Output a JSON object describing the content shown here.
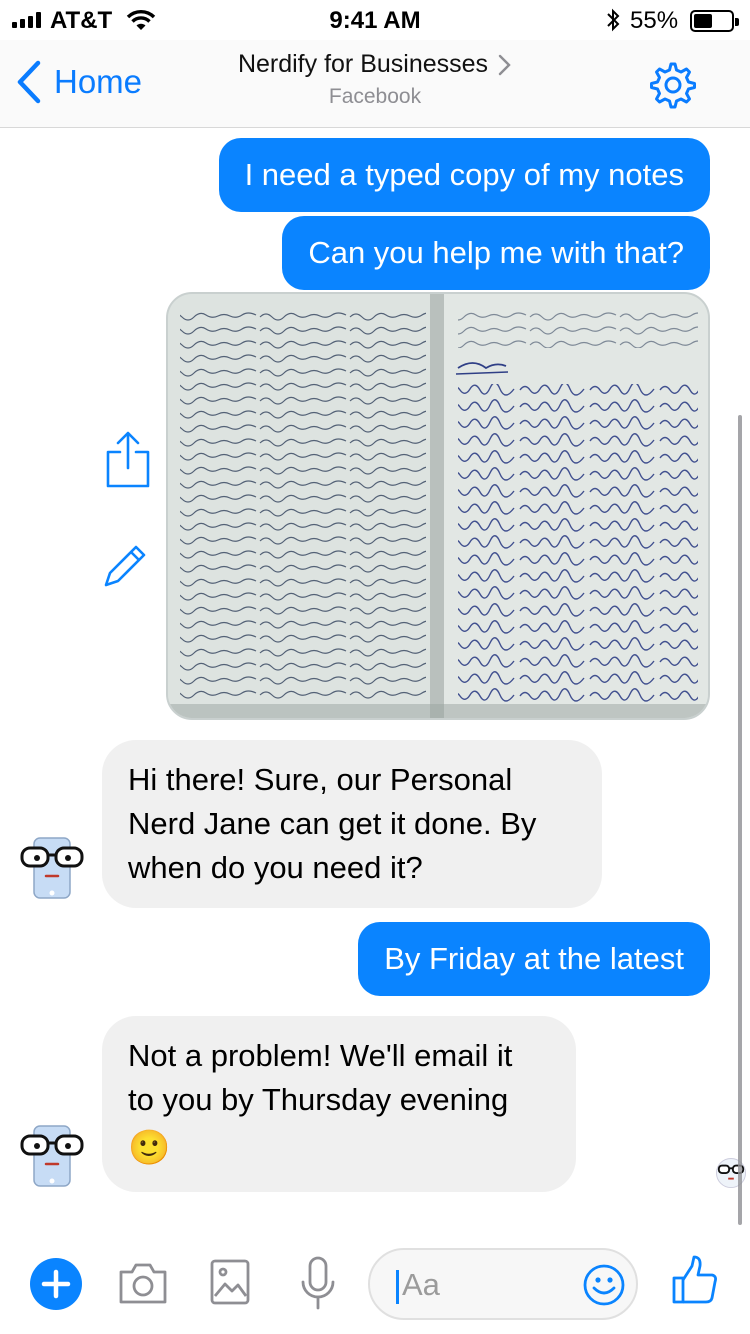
{
  "status_bar": {
    "carrier": "AT&T",
    "time": "9:41 AM",
    "battery_pct": "55%",
    "battery_level": 0.55
  },
  "nav": {
    "back_label": "Home",
    "title": "Nerdify for Businesses",
    "subtitle": "Facebook"
  },
  "messages": [
    {
      "from": "me",
      "text": "I need a typed copy of my notes"
    },
    {
      "from": "me",
      "text": "Can you help me with that?"
    },
    {
      "from": "me",
      "type": "image",
      "image_subject": "photo-of-handwritten-notebook"
    },
    {
      "from": "bot",
      "lines": [
        "Hi there! Sure, our Personal",
        "Nerd Jane can get it done. By",
        "when do you need it?"
      ]
    },
    {
      "from": "me",
      "text": "By Friday at the latest"
    },
    {
      "from": "bot",
      "lines": [
        "Not a problem! We'll email it",
        "to you by Thursday evening"
      ],
      "emoji": "🙂"
    }
  ],
  "composer": {
    "placeholder": "Aa",
    "icons": [
      "plus-icon",
      "camera-icon",
      "gallery-icon",
      "microphone-icon",
      "emoji-icon",
      "thumbs-up-icon"
    ]
  },
  "colors": {
    "accent": "#0a84ff",
    "incoming_bubble": "#f0f0f0",
    "nav_bg": "#fafafa"
  }
}
